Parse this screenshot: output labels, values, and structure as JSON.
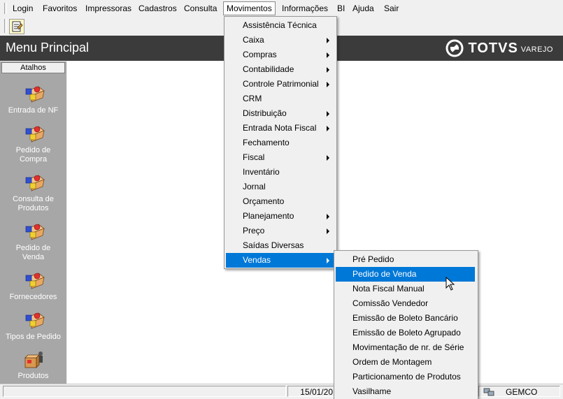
{
  "menubar": {
    "items": [
      "Login",
      "Favoritos",
      "Impressoras",
      "Cadastros",
      "Consulta",
      "Movimentos",
      "Informações",
      "BI",
      "Ajuda",
      "Sair"
    ]
  },
  "header": {
    "title": "Menu Principal",
    "logo_brand": "TOTVS",
    "logo_sub": "VAREJO"
  },
  "sidebar": {
    "header": "Atalhos",
    "shortcuts": [
      {
        "label1": "Entrada de NF",
        "label2": ""
      },
      {
        "label1": "Pedido de",
        "label2": "Compra"
      },
      {
        "label1": "Consulta de",
        "label2": "Produtos"
      },
      {
        "label1": "Pedido de",
        "label2": "Venda"
      },
      {
        "label1": "Fornecedores",
        "label2": ""
      },
      {
        "label1": "Tipos de Pedido",
        "label2": ""
      },
      {
        "label1": "Produtos",
        "label2": ""
      }
    ]
  },
  "movimentos_menu": {
    "items": [
      {
        "label": "Assistência Técnica",
        "submenu": false
      },
      {
        "label": "Caixa",
        "submenu": true
      },
      {
        "label": "Compras",
        "submenu": true
      },
      {
        "label": "Contabilidade",
        "submenu": true
      },
      {
        "label": "Controle Patrimonial",
        "submenu": true
      },
      {
        "label": "CRM",
        "submenu": false
      },
      {
        "label": "Distribuição",
        "submenu": true
      },
      {
        "label": "Entrada Nota Fiscal",
        "submenu": true
      },
      {
        "label": "Fechamento",
        "submenu": false
      },
      {
        "label": "Fiscal",
        "submenu": true
      },
      {
        "label": "Inventário",
        "submenu": false
      },
      {
        "label": "Jornal",
        "submenu": false
      },
      {
        "label": "Orçamento",
        "submenu": false
      },
      {
        "label": "Planejamento",
        "submenu": true
      },
      {
        "label": "Preço",
        "submenu": true
      },
      {
        "label": "Saídas Diversas",
        "submenu": false
      },
      {
        "label": "Vendas",
        "submenu": true,
        "selected": true
      }
    ]
  },
  "vendas_menu": {
    "items": [
      {
        "label": "Pré Pedido"
      },
      {
        "label": "Pedido de Venda",
        "selected": true
      },
      {
        "label": "Nota Fiscal Manual"
      },
      {
        "label": "Comissão Vendedor"
      },
      {
        "label": "Emissão de Boleto Bancário"
      },
      {
        "label": "Emissão de Boleto Agrupado"
      },
      {
        "label": "Movimentação de nr. de Série"
      },
      {
        "label": "Ordem de Montagem"
      },
      {
        "label": "Particionamento de Produtos"
      },
      {
        "label": "Vasilhame"
      }
    ]
  },
  "statusbar": {
    "date": "15/01/20",
    "company": "GEMCO"
  },
  "colors": {
    "header_bg": "#3b3b3b",
    "sidebar_bg": "#a7a7a7",
    "selection": "#0078d7"
  }
}
